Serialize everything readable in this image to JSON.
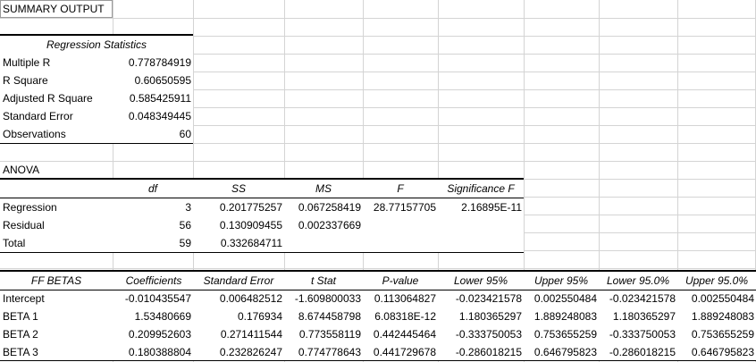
{
  "summary_title": "SUMMARY OUTPUT",
  "regression_statistics": {
    "header": "Regression Statistics",
    "rows": [
      {
        "label": "Multiple R",
        "value": "0.778784919"
      },
      {
        "label": "R Square",
        "value": "0.60650595"
      },
      {
        "label": "Adjusted R Square",
        "value": "0.585425911"
      },
      {
        "label": "Standard Error",
        "value": "0.048349445"
      },
      {
        "label": "Observations",
        "value": "60"
      }
    ]
  },
  "anova": {
    "title": "ANOVA",
    "headers": [
      "df",
      "SS",
      "MS",
      "F",
      "Significance F"
    ],
    "rows": [
      {
        "label": "Regression",
        "cells": [
          "3",
          "0.201775257",
          "0.067258419",
          "28.77157705",
          "2.16895E-11"
        ]
      },
      {
        "label": "Residual",
        "cells": [
          "56",
          "0.130909455",
          "0.002337669",
          "",
          ""
        ]
      },
      {
        "label": "Total",
        "cells": [
          "59",
          "0.332684711",
          "",
          "",
          ""
        ]
      }
    ]
  },
  "coefficients": {
    "headers": [
      "FF BETAS",
      "Coefficients",
      "Standard Error",
      "t Stat",
      "P-value",
      "Lower 95%",
      "Upper 95%",
      "Lower 95.0%",
      "Upper 95.0%"
    ],
    "rows": [
      {
        "label": "Intercept",
        "cells": [
          "-0.010435547",
          "0.006482512",
          "-1.609800033",
          "0.113064827",
          "-0.023421578",
          "0.002550484",
          "-0.023421578",
          "0.002550484"
        ]
      },
      {
        "label": "BETA 1",
        "cells": [
          "1.53480669",
          "0.176934",
          "8.674458798",
          "6.08318E-12",
          "1.180365297",
          "1.889248083",
          "1.180365297",
          "1.889248083"
        ]
      },
      {
        "label": "BETA 2",
        "cells": [
          "0.209952603",
          "0.271411544",
          "0.773558119",
          "0.442445464",
          "-0.333750053",
          "0.753655259",
          "-0.333750053",
          "0.753655259"
        ]
      },
      {
        "label": "BETA 3",
        "cells": [
          "0.180388804",
          "0.232826247",
          "0.774778643",
          "0.441729678",
          "-0.286018215",
          "0.646795823",
          "-0.286018215",
          "0.646795823"
        ]
      }
    ]
  }
}
